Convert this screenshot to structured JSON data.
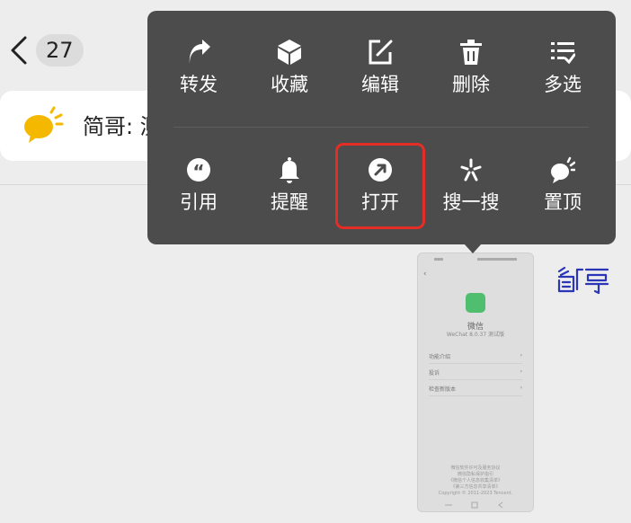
{
  "header": {
    "unread_count": "27"
  },
  "pinned_message": {
    "text": "简哥: 测"
  },
  "context_menu": {
    "row1": [
      {
        "label": "转发",
        "icon": "forward-icon"
      },
      {
        "label": "收藏",
        "icon": "favorite-box-icon"
      },
      {
        "label": "编辑",
        "icon": "edit-icon"
      },
      {
        "label": "删除",
        "icon": "trash-icon"
      },
      {
        "label": "多选",
        "icon": "multi-select-icon"
      }
    ],
    "row2": [
      {
        "label": "引用",
        "icon": "quote-icon"
      },
      {
        "label": "提醒",
        "icon": "bell-icon"
      },
      {
        "label": "打开",
        "icon": "open-external-icon"
      },
      {
        "label": "搜一搜",
        "icon": "sparkle-search-icon"
      },
      {
        "label": "置顶",
        "icon": "pin-top-icon"
      }
    ],
    "highlighted_item": "打开"
  },
  "thumbnail": {
    "app_name": "微信",
    "version": "WeChat 8.0.37 测试版",
    "rows": [
      "功能介绍",
      "投诉",
      "检查新版本"
    ],
    "footer_lines": [
      "微信软件许可及服务协议",
      "微信隐私保护指引",
      "《微信个人信息收集清单》",
      "《第三方信息共享清单》",
      "Copyright © 2011-2023 Tencent."
    ]
  },
  "signature": "简哥",
  "colors": {
    "background": "#ededed",
    "menu_background": "#4c4c4c",
    "highlight": "#e52d27",
    "avatar_yellow": "#f5b800",
    "signature_blue": "#2a35b8"
  }
}
